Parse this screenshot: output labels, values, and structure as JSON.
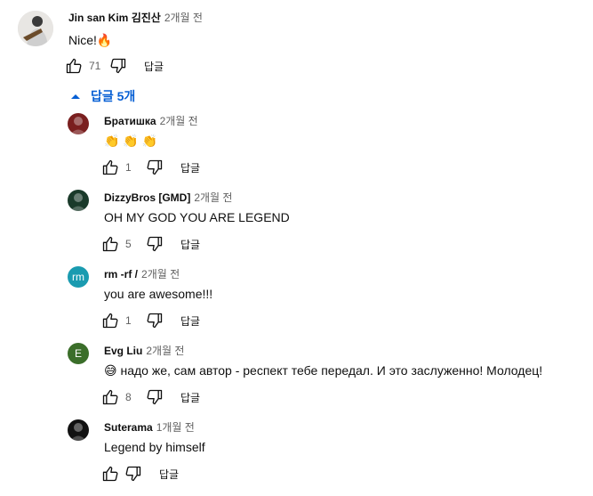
{
  "comment": {
    "author": "Jin san Kim 김진산",
    "time": "2개월 전",
    "text": "Nice!🔥",
    "likes": "71",
    "reply_label": "답글"
  },
  "replies_toggle": {
    "label": "답글 5개"
  },
  "replies": [
    {
      "author": "Братишка",
      "time": "2개월 전",
      "text": "👏 👏 👏",
      "likes": "1",
      "reply_label": "답글",
      "avatar_color": "#7a1f1f"
    },
    {
      "author": "DizzyBros [GMD]",
      "time": "2개월 전",
      "text": "OH MY GOD YOU ARE LEGEND",
      "likes": "5",
      "reply_label": "답글",
      "avatar_color": "#1a3a2a"
    },
    {
      "author": "rm -rf /",
      "time": "2개월 전",
      "text": "you are awesome!!!",
      "likes": "1",
      "reply_label": "답글",
      "avatar_initial": "rm",
      "avatar_color": "#1a9bb0"
    },
    {
      "author": "Evg Liu",
      "time": "2개월 전",
      "text": "😅 надо же, сам автор - респект тебе передал. И это  заслуженно! Молодец!",
      "likes": "8",
      "reply_label": "답글",
      "avatar_initial": "E",
      "avatar_color": "#3b6e2a"
    },
    {
      "author": "Suterama",
      "time": "1개월 전",
      "text": "Legend by himself",
      "likes": "",
      "reply_label": "답글",
      "avatar_color": "#111111"
    }
  ]
}
